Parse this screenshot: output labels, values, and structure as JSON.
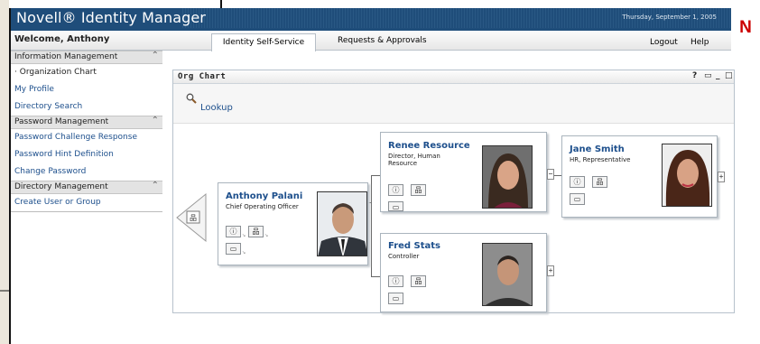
{
  "header": {
    "app_title": "Novell® Identity Manager",
    "date": "Thursday, September 1, 2005",
    "logo_letter": "N"
  },
  "nav": {
    "welcome": "Welcome, Anthony",
    "tabs": [
      {
        "label": "Identity Self-Service",
        "active": true
      },
      {
        "label": "Requests & Approvals",
        "active": false
      }
    ],
    "logout": "Logout",
    "help": "Help"
  },
  "sidebar": {
    "sections": [
      {
        "title": "Information Management",
        "items": [
          "Organization Chart",
          "My Profile",
          "Directory Search"
        ]
      },
      {
        "title": "Password Management",
        "items": [
          "Password Challenge Response",
          "Password Hint Definition",
          "Change Password"
        ]
      },
      {
        "title": "Directory Management",
        "items": [
          "Create User or Group"
        ]
      }
    ],
    "current": "Organization Chart"
  },
  "panel": {
    "title": "Org Chart",
    "lookup": "Lookup",
    "controls": {
      "help": "?",
      "print": "▭",
      "minimize": "_",
      "maximize": "□"
    }
  },
  "people": {
    "anthony": {
      "name": "Anthony Palani",
      "title": "Chief Operating Officer"
    },
    "renee": {
      "name": "Renee Resource",
      "title": "Director, Human Resource"
    },
    "jane": {
      "name": "Jane Smith",
      "title": "HR, Representative"
    },
    "fred": {
      "name": "Fred Stats",
      "title": "Controller"
    }
  },
  "icons": {
    "info": "ⓘ",
    "org": "品",
    "email": "▭",
    "expand": "+",
    "collapse": "−",
    "back": "品"
  },
  "colors": {
    "link": "#1d4f8c",
    "header": "#1f4d7a",
    "novell_red": "#cc0000"
  }
}
